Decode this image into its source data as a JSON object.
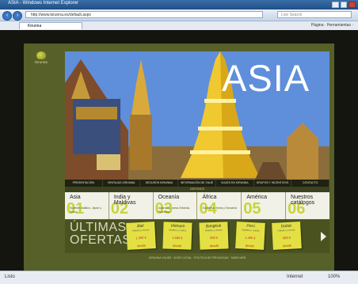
{
  "browser": {
    "title": "ASIA - Windows Internet Explorer",
    "url": "http://www.kirunna.es/default.aspx",
    "search_placeholder": "Live Search",
    "tab_label": "Kirunna",
    "tools": "Página · Herramientas ·",
    "status_left": "Listo",
    "status_zone": "Internet",
    "status_zoom": "100%"
  },
  "site": {
    "logo_text": "Kirunna",
    "hero_title": "ASIA",
    "nav": [
      "PRESENTACIÓN",
      "VENTAJAS KIRUNNA",
      "SEGUROS KIRUNNA",
      "INFORMACIÓN DE VIAJE",
      "VIAJES EN KIRUNNA",
      "GRUPOS Y INCENTIVOS",
      "CONTACTO"
    ],
    "strip_text": "DESTINOS",
    "destinations": [
      {
        "num": "01",
        "name": "Asia",
        "sub": "Sudeste Asiático, Japón y China"
      },
      {
        "num": "02",
        "name": "India y Maldivas",
        "sub": ""
      },
      {
        "num": "03",
        "name": "Oceanía",
        "sub": "Australia, Nueva Zelanda, Polinesia"
      },
      {
        "num": "04",
        "name": "África",
        "sub": "Sudáfrica, Kenia y Tanzania"
      },
      {
        "num": "05",
        "name": "América",
        "sub": ""
      },
      {
        "num": "06",
        "name": "Nuestros catálogos",
        "sub": ""
      }
    ],
    "offers_title": "ÚLTIMAS OFERTAS",
    "offers": [
      {
        "title": "Bali",
        "desc": "Hoteles y vuelos",
        "price": "1.350 €",
        "from": "desde"
      },
      {
        "title": "Vietnam",
        "desc": "Hoteles y vuelos",
        "price": "1.690 €",
        "from": "desde"
      },
      {
        "title": "Bangkok",
        "desc": "Hoteles y vuelos",
        "price": "990 €",
        "from": "desde"
      },
      {
        "title": "Perú",
        "desc": "Hoteles y vuelos",
        "price": "1.490 €",
        "from": "desde"
      },
      {
        "title": "Dubái",
        "desc": "Hoteles y vuelos",
        "price": "890 €",
        "from": "desde"
      }
    ],
    "footer": "KIRUNNA VIAJES · AVISO LEGAL · POLÍTICA DE PRIVACIDAD · MAPA WEB"
  }
}
